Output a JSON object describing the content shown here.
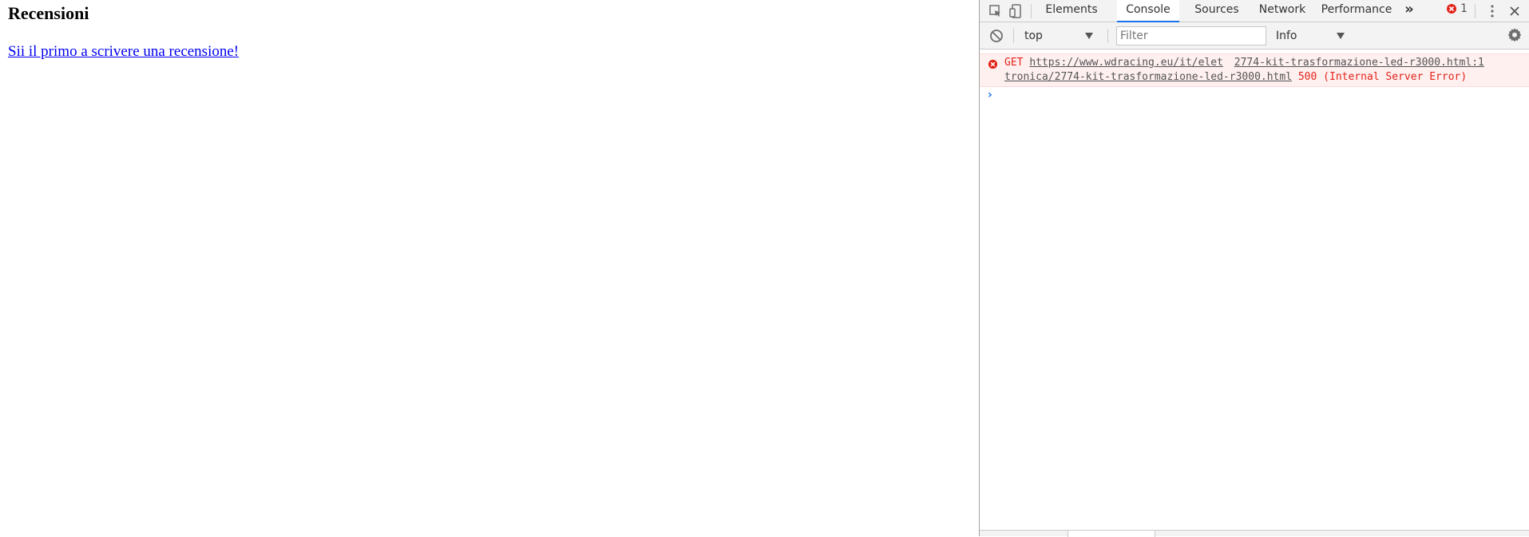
{
  "page": {
    "heading": "Recensioni",
    "review_link": "Sii il primo a scrivere una recensione!"
  },
  "devtools": {
    "tabs": [
      {
        "label": "Elements"
      },
      {
        "label": "Console"
      },
      {
        "label": "Sources"
      },
      {
        "label": "Network"
      },
      {
        "label": "Performance"
      }
    ],
    "more_tabs": "»",
    "error_count": "1",
    "toolbar": {
      "context": "top",
      "filter_placeholder": "Filter",
      "level": "Info"
    },
    "console": {
      "error": {
        "method": "GET",
        "url_part1": "https://www.wdracing.eu/it/elet",
        "url_part2": "tronica/2774-kit-trasformazione-led-r3000.html",
        "source_link": "2774-kit-trasformazione-led-r3000.html:1",
        "status": "500 (Internal Server Error)"
      },
      "prompt": "›"
    },
    "colors": {
      "active_tab": "#1a73e8",
      "error_text": "#ff0000",
      "error_bg": "#fff0f0"
    }
  }
}
